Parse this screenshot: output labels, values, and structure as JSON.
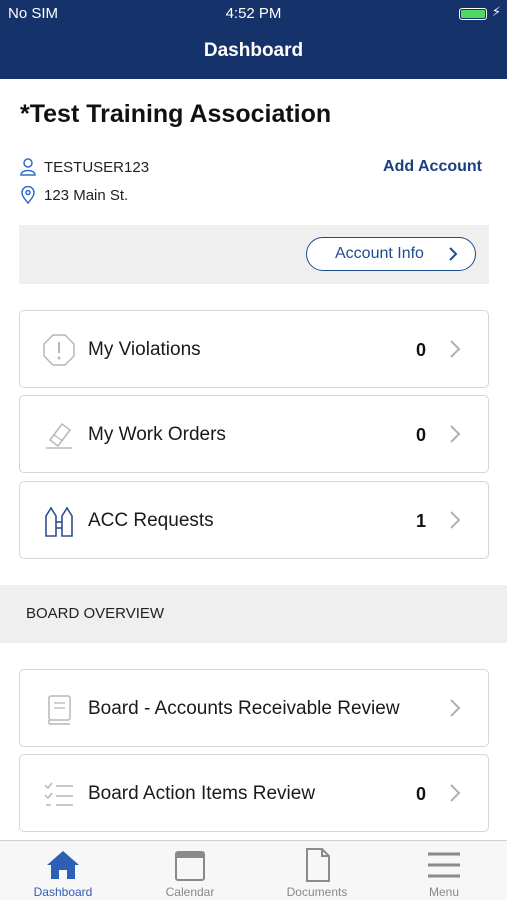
{
  "status_bar": {
    "carrier": "No SIM",
    "time": "4:52 PM"
  },
  "header": {
    "title": "Dashboard"
  },
  "association": {
    "name": "*Test Training Association",
    "username": "TESTUSER123",
    "address": "123 Main St.",
    "add_account_label": "Add Account",
    "account_info_label": "Account Info"
  },
  "cards": [
    {
      "label": "My Violations",
      "count": "0",
      "icon": "violation-icon"
    },
    {
      "label": "My Work Orders",
      "count": "0",
      "icon": "work-order-icon"
    },
    {
      "label": "ACC Requests",
      "count": "1",
      "icon": "acc-request-icon"
    }
  ],
  "board_overview": {
    "title": "BOARD OVERVIEW",
    "items": [
      {
        "label": "Board - Accounts Receivable Review",
        "count": "",
        "icon": "book-icon"
      },
      {
        "label": "Board Action Items Review",
        "count": "0",
        "icon": "checklist-icon"
      }
    ]
  },
  "tabs": [
    {
      "label": "Dashboard",
      "icon": "home-icon",
      "active": true
    },
    {
      "label": "Calendar",
      "icon": "calendar-icon",
      "active": false
    },
    {
      "label": "Documents",
      "icon": "document-icon",
      "active": false
    },
    {
      "label": "Menu",
      "icon": "hamburger-icon",
      "active": false
    }
  ],
  "colors": {
    "header_bg": "#16326b",
    "accent": "#1e4d8c",
    "active_tab": "#2d5fb5",
    "battery": "#4cd964"
  }
}
